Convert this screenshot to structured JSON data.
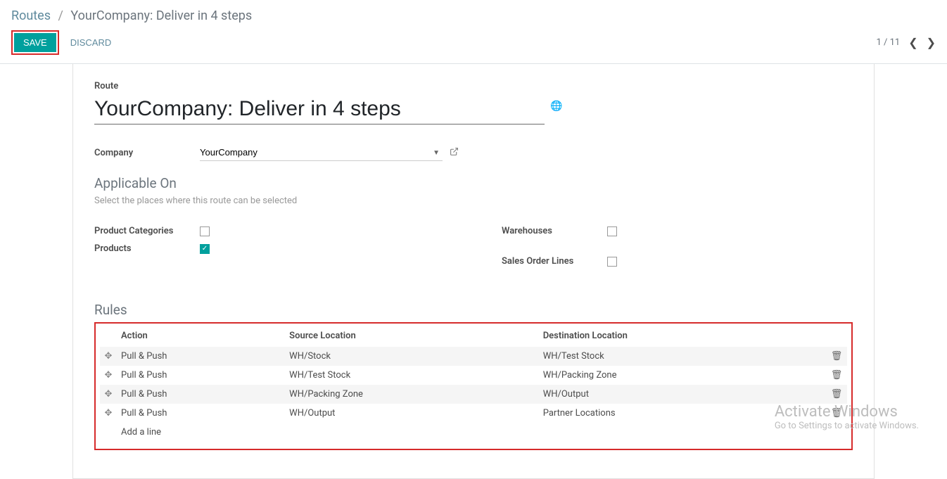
{
  "breadcrumb": {
    "root": "Routes",
    "sep": "/",
    "current": "YourCompany: Deliver in 4 steps"
  },
  "toolbar": {
    "save": "SAVE",
    "discard": "DISCARD",
    "pager": "1 / 11"
  },
  "route": {
    "label": "Route",
    "value": "YourCompany: Deliver in 4 steps"
  },
  "company": {
    "label": "Company",
    "value": "YourCompany"
  },
  "applicable": {
    "title": "Applicable On",
    "subtitle": "Select the places where this route can be selected"
  },
  "checks": {
    "product_categories": "Product Categories",
    "products": "Products",
    "warehouses": "Warehouses",
    "sales_order_lines": "Sales Order Lines"
  },
  "rules": {
    "title": "Rules",
    "cols": {
      "action": "Action",
      "source": "Source Location",
      "dest": "Destination Location"
    },
    "rows": [
      {
        "action": "Pull & Push",
        "source": "WH/Stock",
        "dest": "WH/Test Stock"
      },
      {
        "action": "Pull & Push",
        "source": "WH/Test Stock",
        "dest": "WH/Packing Zone"
      },
      {
        "action": "Pull & Push",
        "source": "WH/Packing Zone",
        "dest": "WH/Output"
      },
      {
        "action": "Pull & Push",
        "source": "WH/Output",
        "dest": "Partner Locations"
      }
    ],
    "add": "Add a line"
  },
  "watermark": {
    "title": "Activate Windows",
    "sub": "Go to Settings to activate Windows."
  }
}
